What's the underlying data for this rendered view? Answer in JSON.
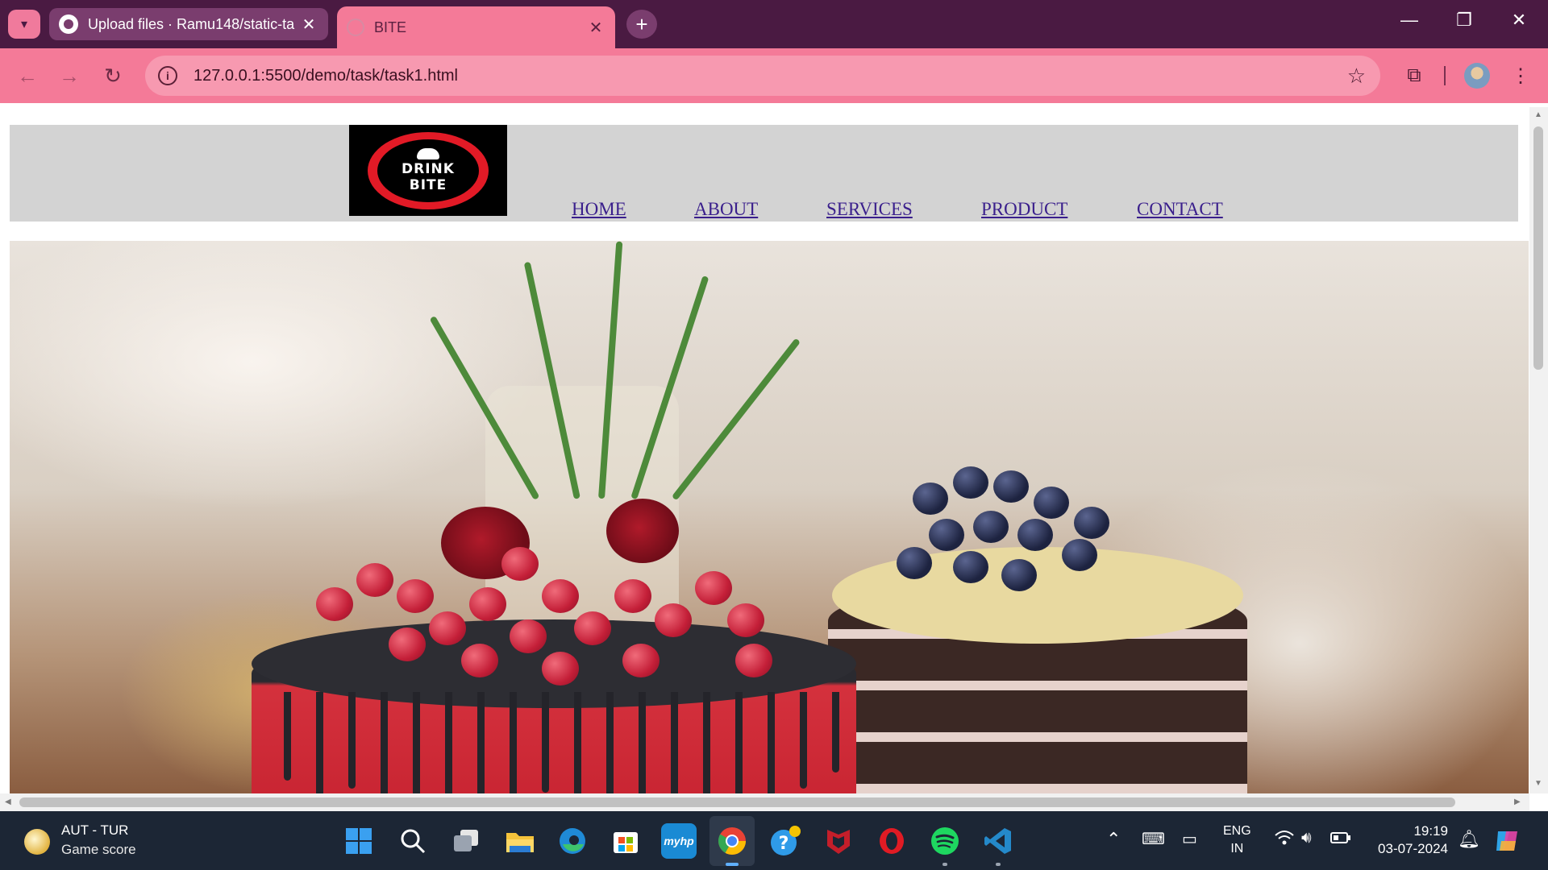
{
  "browser": {
    "tabs": [
      {
        "title": "Upload files · Ramu148/static-ta",
        "icon": "github-icon",
        "active": false
      },
      {
        "title": "BITE",
        "icon": "globe-icon",
        "active": true
      }
    ],
    "new_tab_symbol": "+",
    "close_symbol": "✕",
    "window_controls": {
      "minimize": "—",
      "restore": "❐",
      "close": "✕"
    },
    "nav": {
      "back": "←",
      "forward": "→",
      "reload": "↻"
    },
    "url": "127.0.0.1:5500/demo/task/task1.html",
    "bookmark_symbol": "☆",
    "extensions_symbol": "⧉",
    "menu_symbol": "⋮",
    "theme_color": "#f47a98",
    "tabbar_color": "#4a1a42"
  },
  "site": {
    "logo_text": [
      "DRINK",
      "BITE"
    ],
    "logo_colors": {
      "ring": "#e21a26",
      "background": "#000000"
    },
    "nav": [
      "HOME",
      "ABOUT",
      "SERVICES",
      "PRODUCT",
      "CONTACT"
    ],
    "nav_link_color": "#3a1f8c",
    "header_color": "#d3d3d3"
  },
  "taskbar": {
    "weather": {
      "title": "AUT - TUR",
      "subtitle": "Game score"
    },
    "apps": [
      "start-icon",
      "search-icon",
      "task-view-icon",
      "file-explorer-icon",
      "edge-icon",
      "store-icon",
      "myhp-icon",
      "chrome-icon",
      "help-icon",
      "mcafee-icon",
      "opera-icon",
      "spotify-icon",
      "vscode-icon"
    ],
    "myhp_label": "myhp",
    "language": [
      "ENG",
      "IN"
    ],
    "time": "19:19",
    "date": "03-07-2024"
  }
}
